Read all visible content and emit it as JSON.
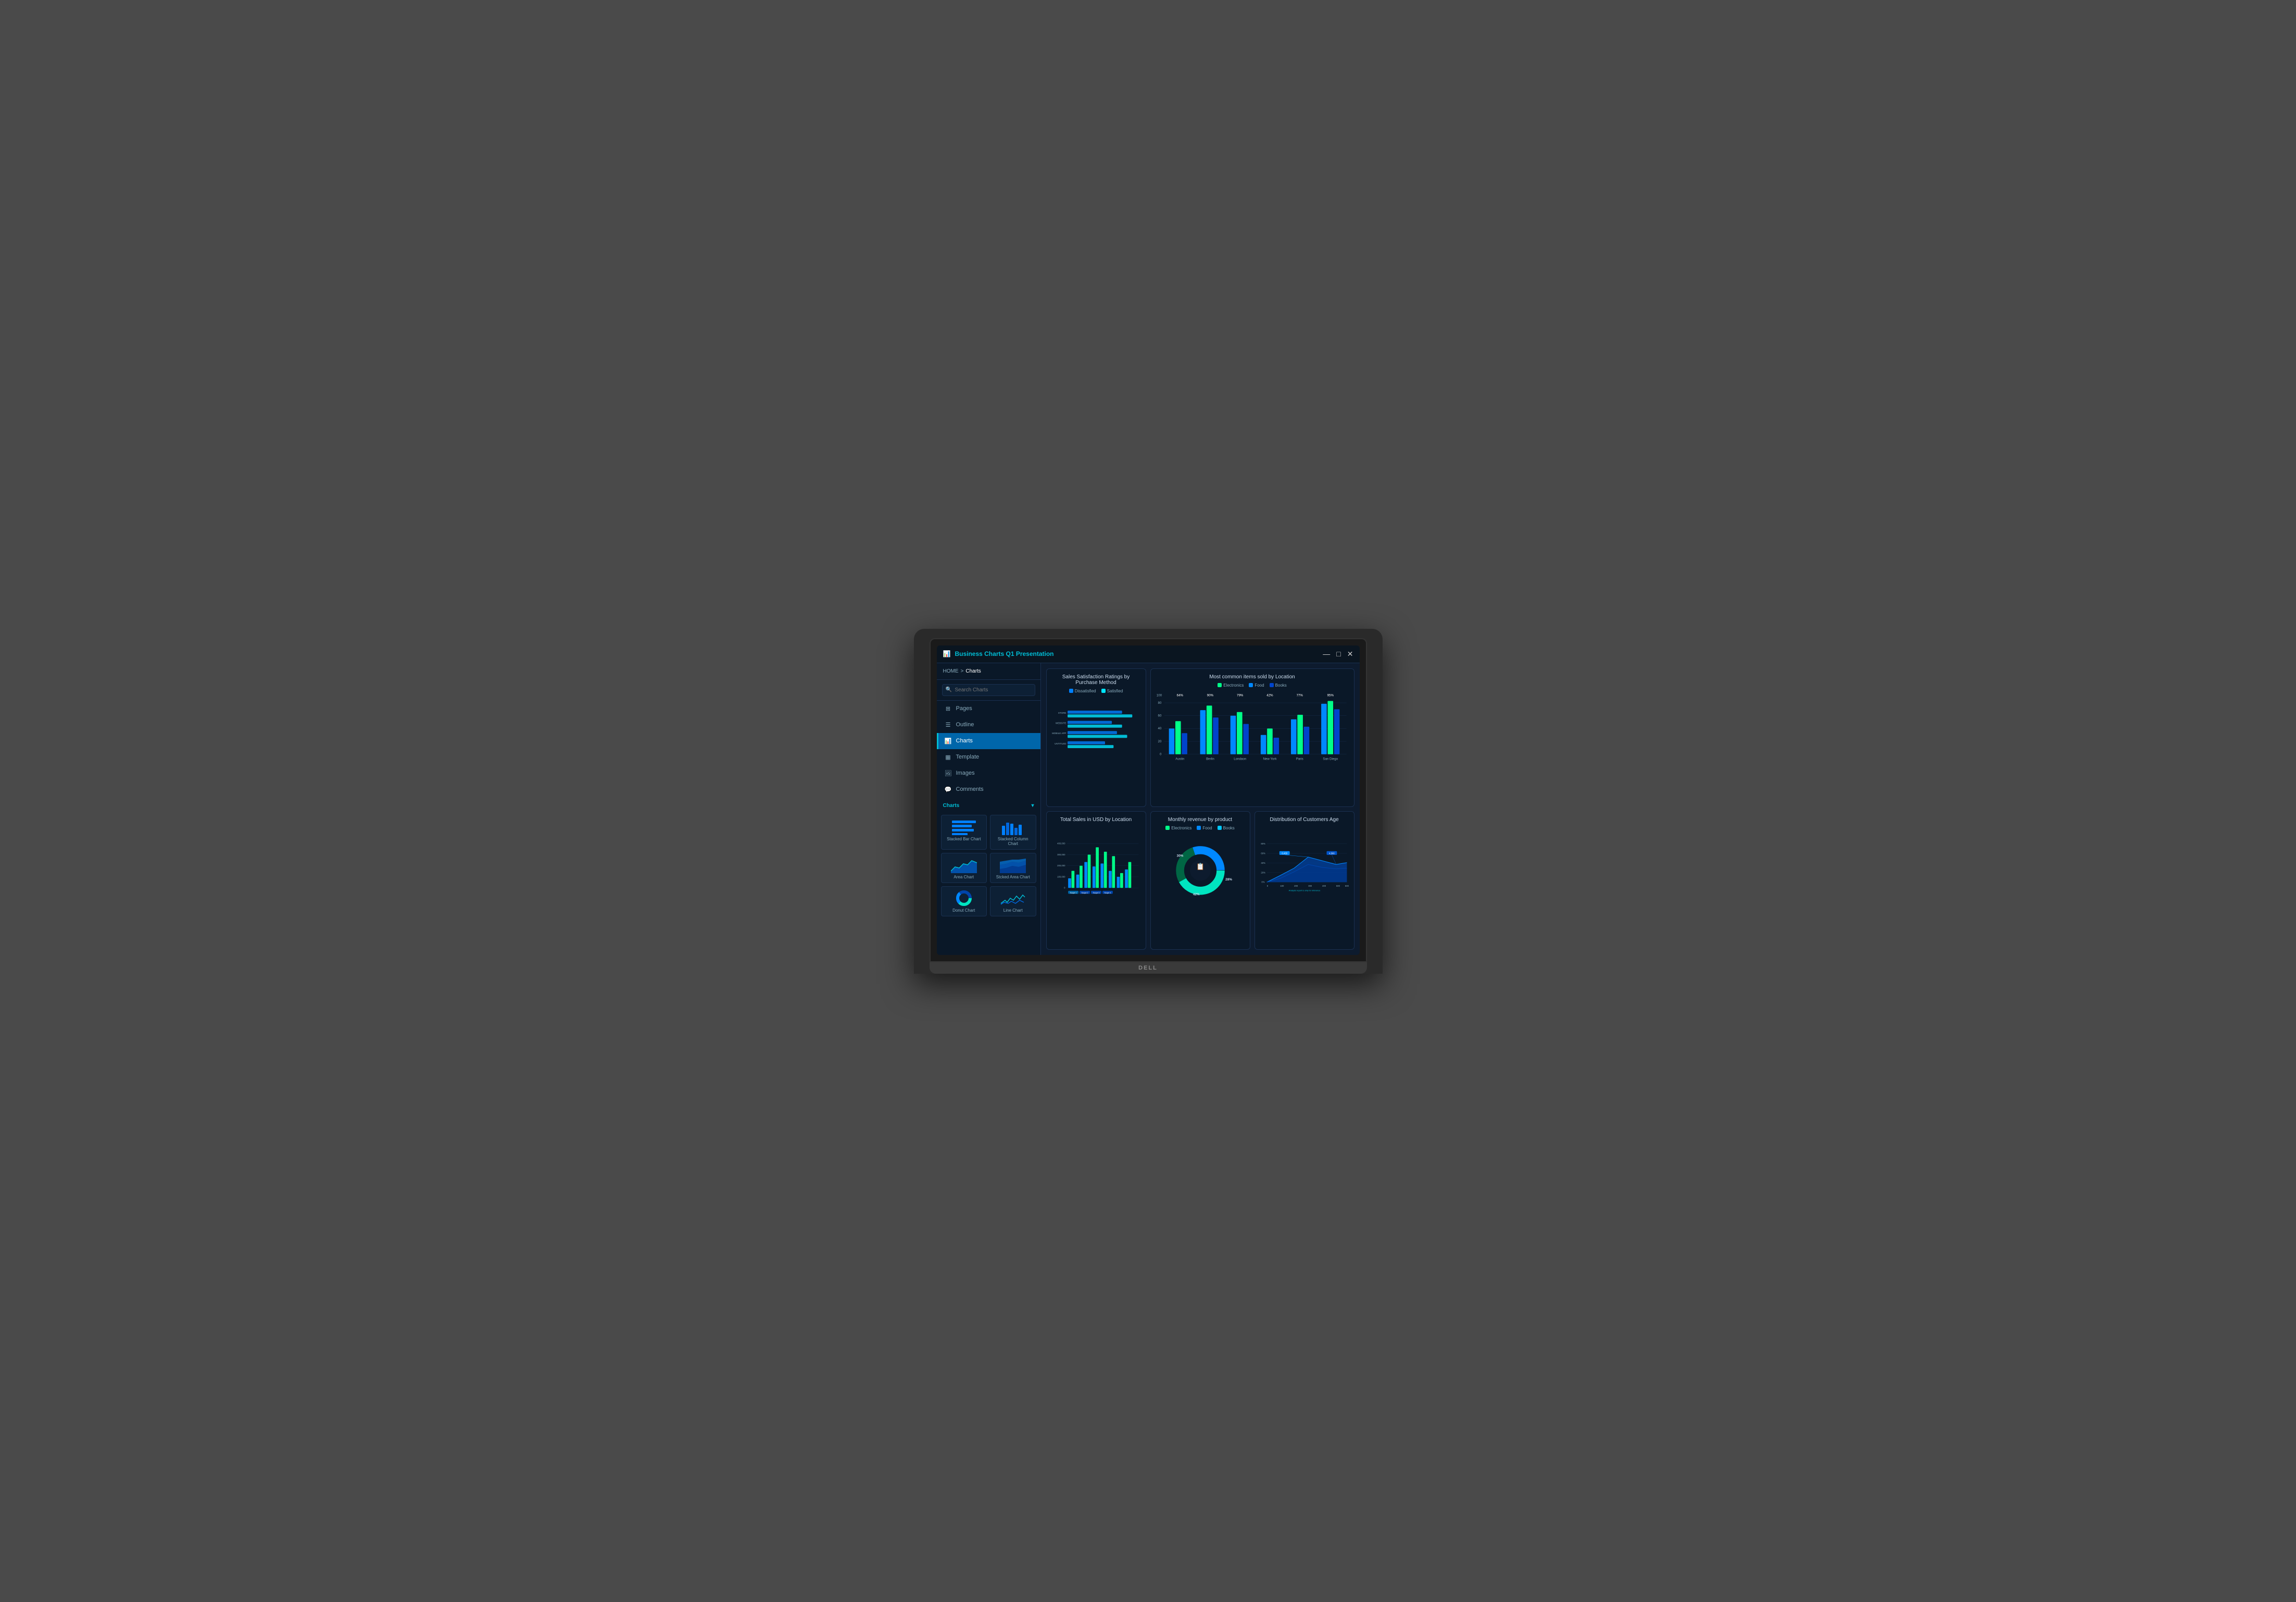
{
  "window": {
    "title": "Business Charts Q1 Presentation",
    "icon": "📊"
  },
  "titlebar": {
    "minimize": "—",
    "maximize": "□",
    "close": "✕"
  },
  "breadcrumb": {
    "home": "HOME",
    "separator": ">",
    "current": "Charts"
  },
  "search": {
    "placeholder": "Search Charts"
  },
  "nav": {
    "items": [
      {
        "id": "pages",
        "label": "Pages",
        "icon": "⊞"
      },
      {
        "id": "outline",
        "label": "Outline",
        "icon": "☰"
      },
      {
        "id": "charts",
        "label": "Charts",
        "icon": "📊",
        "active": true
      },
      {
        "id": "template",
        "label": "Template",
        "icon": "▦"
      },
      {
        "id": "images",
        "label": "Images",
        "icon": "🖼"
      },
      {
        "id": "comments",
        "label": "Comments",
        "icon": "💬"
      }
    ]
  },
  "sidebar_section": {
    "label": "Charts",
    "toggle": "▾"
  },
  "chart_thumbs": [
    {
      "id": "stacked-bar",
      "label": "Stacked Bar Chart"
    },
    {
      "id": "stacked-col",
      "label": "Stacked Column Chart"
    },
    {
      "id": "area",
      "label": "Area Chart"
    },
    {
      "id": "stacked-area",
      "label": "Stcked Area Chart"
    },
    {
      "id": "donut",
      "label": "Donut Chart"
    },
    {
      "id": "line",
      "label": "Line Chart"
    }
  ],
  "charts": {
    "sales_satisfaction": {
      "title": "Sales Satisfaction Ratings by Purchase Method",
      "legend": [
        {
          "label": "Dissatisfied",
          "color": "#0080ff"
        },
        {
          "label": "Satisfied",
          "color": "#00e5ff"
        }
      ],
      "categories": [
        "STORE",
        "WEBSITE",
        "MOBILE APP",
        "UNTITLED"
      ],
      "dissatisfied": [
        75,
        62,
        70,
        55
      ],
      "satisfied": [
        90,
        80,
        85,
        65
      ]
    },
    "common_items": {
      "title": "Most common items sold by Location",
      "legend": [
        {
          "label": "Electronics",
          "color": "#00ff88"
        },
        {
          "label": "Food",
          "color": "#0088ff"
        },
        {
          "label": "Books",
          "color": "#0044cc"
        }
      ],
      "locations": [
        "Austin",
        "Berlin",
        "Londaon",
        "New York",
        "Paris",
        "San Diego"
      ],
      "percentages": [
        "64%",
        "90%",
        "79%",
        "42%",
        "77%",
        "95%"
      ]
    },
    "total_sales": {
      "title": "Total Sales in USD by Location",
      "yLabels": [
        "0",
        "100,000",
        "200,000",
        "300,000",
        "400,000"
      ],
      "scopes": [
        "Scope 1",
        "Scope 2",
        "Scope 3",
        "Scope 4"
      ]
    },
    "monthly_revenue": {
      "title": "Monthly revenue by product",
      "legend": [
        {
          "label": "Electronics",
          "color": "#00ff88"
        },
        {
          "label": "Food",
          "color": "#0088ff"
        },
        {
          "label": "Books",
          "color": "#00c8ff"
        }
      ],
      "segments": [
        {
          "label": "30%",
          "color": "#0088ff"
        },
        {
          "label": "28%",
          "color": "#006644"
        },
        {
          "label": "42%",
          "color": "#00e5c0"
        }
      ]
    },
    "customer_age": {
      "title": "Distribution of Customers Age",
      "yLabels": [
        "0%",
        "20%",
        "40%",
        "60%",
        "80%"
      ],
      "xLabels": [
        "0",
        "100",
        "200",
        "300",
        "400",
        "500",
        "600"
      ],
      "annotations": [
        {
          "label": "6,455",
          "color": "#0088ff"
        },
        {
          "label": "4,566",
          "color": "#0044aa"
        }
      ],
      "footnote": "Analysis report is only for reference"
    }
  }
}
